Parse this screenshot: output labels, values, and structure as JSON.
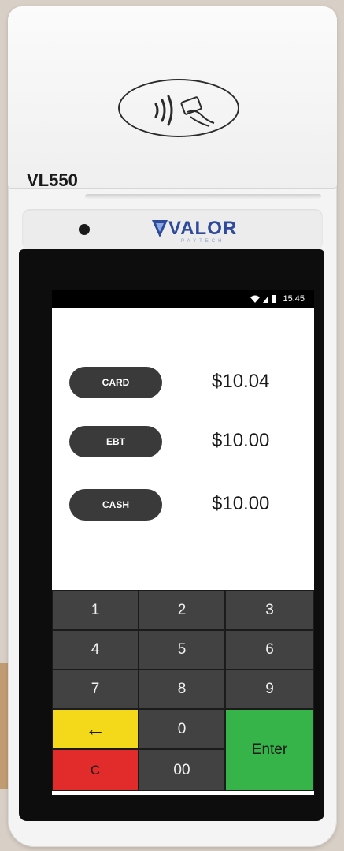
{
  "device": {
    "model": "VL550",
    "brand": "VALOR",
    "brand_sub": "PAYTECH"
  },
  "status_bar": {
    "time": "15:45",
    "icons": [
      "wifi-icon",
      "cellular-icon",
      "battery-icon"
    ]
  },
  "tenders": [
    {
      "label": "CARD",
      "amount": "$10.04"
    },
    {
      "label": "EBT",
      "amount": "$10.00"
    },
    {
      "label": "CASH",
      "amount": "$10.00"
    }
  ],
  "keypad": {
    "k1": "1",
    "k2": "2",
    "k3": "3",
    "k4": "4",
    "k5": "5",
    "k6": "6",
    "k7": "7",
    "k8": "8",
    "k9": "9",
    "k0": "0",
    "k00": "00",
    "backspace": "←",
    "clear": "C",
    "enter": "Enter"
  },
  "colors": {
    "backspace_key": "#f3d91a",
    "clear_key": "#e22b2b",
    "enter_key": "#36b44a",
    "tender_button": "#3a3a3a",
    "brand": "#2f4a9a"
  },
  "nav": {
    "back_icon": "back-triangle-icon"
  }
}
